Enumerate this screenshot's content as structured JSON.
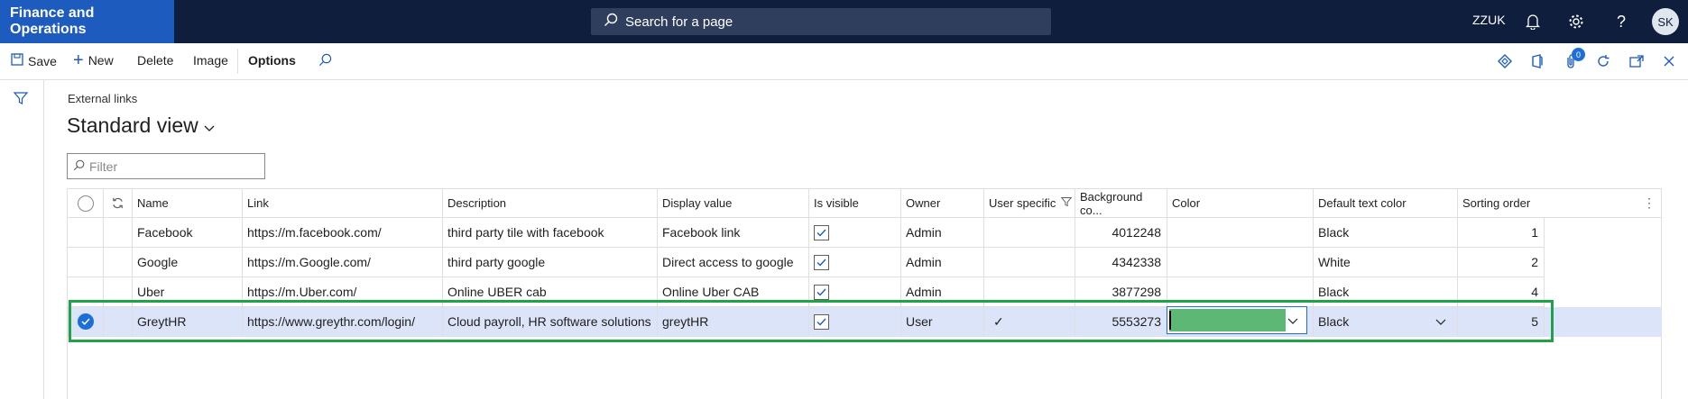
{
  "app": {
    "title": "Finance and Operations",
    "company": "ZZUK",
    "user_initials": "SK"
  },
  "search": {
    "label": "Search for a page"
  },
  "actions": {
    "save": "Save",
    "new": "New",
    "delete": "Delete",
    "image": "Image",
    "options": "Options",
    "notification_count": "0"
  },
  "page": {
    "caption": "External links",
    "view_title": "Standard view",
    "filter_placeholder": "Filter"
  },
  "grid": {
    "columns": [
      "Name",
      "Link",
      "Description",
      "Display value",
      "Is visible",
      "Owner",
      "User specific",
      "Background co...",
      "Color",
      "Default text color",
      "Sorting order"
    ],
    "rows": [
      {
        "name": "Facebook",
        "link": "https://m.facebook.com/",
        "description": "third party tile with facebook",
        "display": "Facebook link",
        "visible": true,
        "owner": "Admin",
        "user_specific": "",
        "background": "4012248",
        "color": "",
        "text_color": "Black",
        "sorting": "1"
      },
      {
        "name": "Google",
        "link": "https://m.Google.com/",
        "description": "third party google",
        "display": "Direct access to google",
        "visible": true,
        "owner": "Admin",
        "user_specific": "",
        "background": "4342338",
        "color": "",
        "text_color": "White",
        "sorting": "2"
      },
      {
        "name": "Uber",
        "link": "https://m.Uber.com/",
        "description": "Online UBER cab",
        "display": "Online Uber CAB",
        "visible": true,
        "owner": "Admin",
        "user_specific": "",
        "background": "3877298",
        "color": "",
        "text_color": "Black",
        "sorting": "4"
      },
      {
        "name": "GreytHR",
        "link": "https://www.greythr.com/login/",
        "description": "Cloud payroll, HR software solutions",
        "display": "greytHR",
        "visible": true,
        "owner": "User",
        "user_specific": "✓",
        "background": "5553273",
        "color": "#5cb874",
        "text_color": "Black",
        "sorting": "5"
      }
    ]
  },
  "colors": {
    "brand": "#1d5bbf",
    "topbar": "#0f1e3c",
    "selected_row": "#dbe4f8",
    "highlight": "#21a148",
    "swatch": "#5cb874"
  }
}
